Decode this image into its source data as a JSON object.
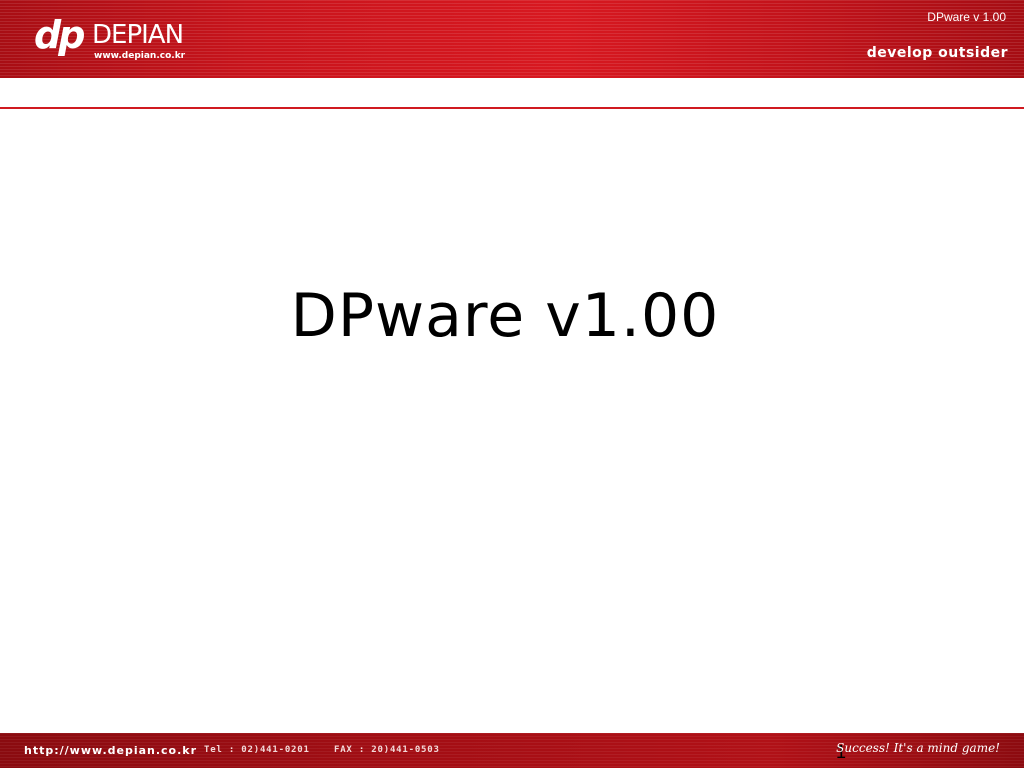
{
  "header": {
    "logo_mark": "dp",
    "logo_name": "DEPIAN",
    "logo_url": "www.depian.co.kr",
    "title": "DPware v 1.00",
    "tagline": "develop outsider"
  },
  "slide": {
    "title": "DPware v1.00",
    "page_number": "1"
  },
  "footer": {
    "url": "http://www.depian.co.kr",
    "tel": "Tel : 02)441-0201",
    "fax": "FAX : 20)441-0503",
    "slogan": "Success! It's a mind game!"
  },
  "colors": {
    "header_red": "#d81820",
    "footer_red": "#a30e14",
    "rule_red": "#d01a20"
  }
}
